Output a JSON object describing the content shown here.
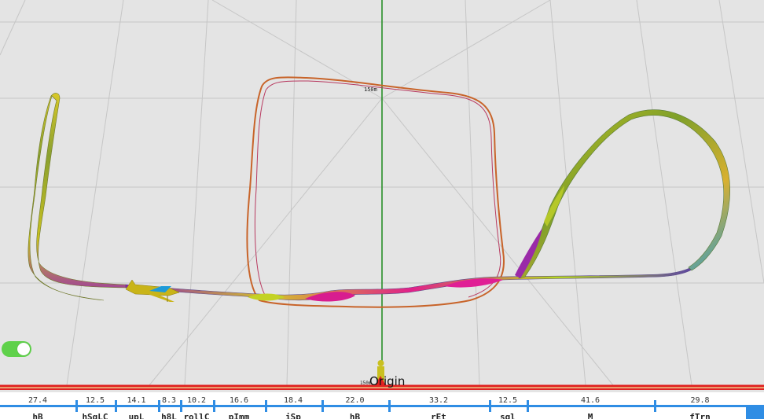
{
  "scene": {
    "origin_label": "Origin",
    "altitude_label": "150m",
    "distance_label": "150m",
    "colors": {
      "background": "#e4e4e4",
      "grid": "#c8c8c8",
      "y_axis": "#1d8a1d",
      "track": "#cc6a2a",
      "box_line": "#e02222",
      "aircraft": "#c9b418"
    }
  },
  "toggle": {
    "state": "on"
  },
  "timeline": {
    "segments": [
      {
        "dur": "27.4",
        "name": "hB"
      },
      {
        "dur": "12.5",
        "name": "hSqLC"
      },
      {
        "dur": "14.1",
        "name": "upL"
      },
      {
        "dur": "8.3",
        "name": "h8L"
      },
      {
        "dur": "10.2",
        "name": "rollC"
      },
      {
        "dur": "16.6",
        "name": "pImm"
      },
      {
        "dur": "18.4",
        "name": "iSp"
      },
      {
        "dur": "22.0",
        "name": "hB"
      },
      {
        "dur": "33.2",
        "name": "rEt"
      },
      {
        "dur": "12.5",
        "name": "sql"
      },
      {
        "dur": "41.6",
        "name": "M"
      },
      {
        "dur": "29.8",
        "name": "fTrn"
      }
    ]
  }
}
